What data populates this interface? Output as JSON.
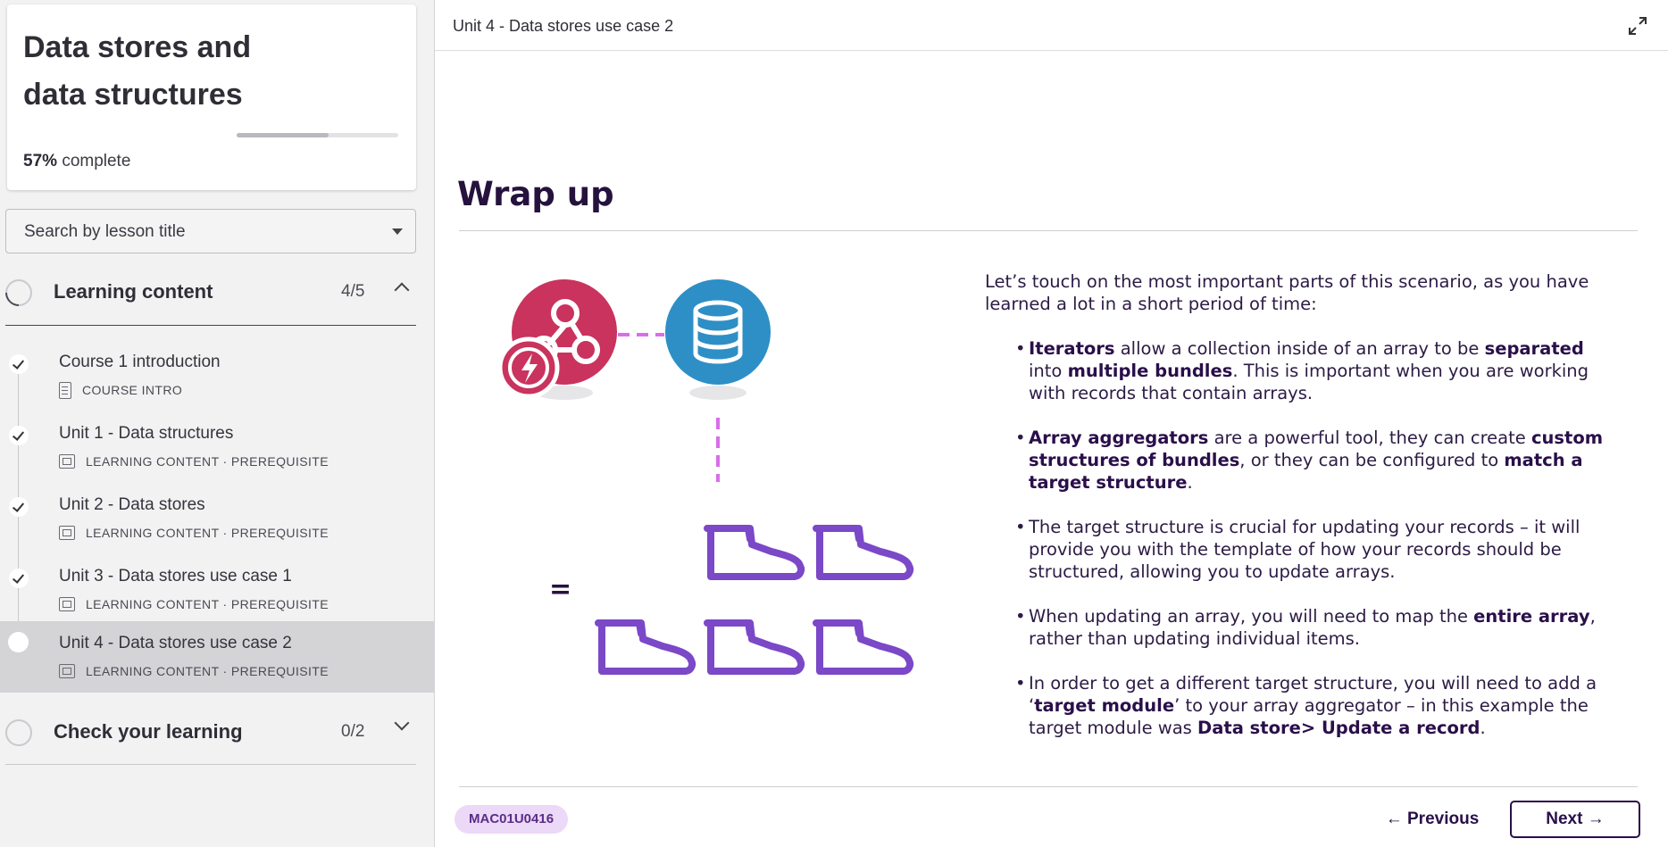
{
  "course": {
    "title": "Data stores and data structures",
    "progress_percent": 57,
    "progress_value": "57%",
    "progress_suffix": "complete"
  },
  "search": {
    "label": "Search by lesson title"
  },
  "sections": [
    {
      "title": "Learning content",
      "count": "4/5",
      "expanded": true
    },
    {
      "title": "Check your learning",
      "count": "0/2",
      "expanded": false
    }
  ],
  "lessons": [
    {
      "title": "Course 1 introduction",
      "meta": "COURSE INTRO",
      "status": "complete"
    },
    {
      "title": "Unit 1 - Data structures",
      "meta": "LEARNING CONTENT · PREREQUISITE",
      "status": "complete"
    },
    {
      "title": "Unit 2 - Data stores",
      "meta": "LEARNING CONTENT · PREREQUISITE",
      "status": "complete"
    },
    {
      "title": "Unit 3 - Data stores use case 1",
      "meta": "LEARNING CONTENT · PREREQUISITE",
      "status": "complete"
    },
    {
      "title": "Unit 4 - Data stores use case 2",
      "meta": "LEARNING CONTENT · PREREQUISITE",
      "status": "current"
    }
  ],
  "header": {
    "breadcrumb": "Unit 4 - Data stores use case 2"
  },
  "content": {
    "heading": "Wrap up",
    "equals": "=",
    "intro": "Let’s touch on the most important parts of this scenario, as you have learned a lot in a short period of time:",
    "bullets": [
      [
        {
          "b": "Iterators"
        },
        {
          "t": " allow a collection inside of an array to be "
        },
        {
          "b": "separated"
        },
        {
          "t": " into "
        },
        {
          "b": "multiple bundles"
        },
        {
          "t": ". This is important when you are working with records that contain arrays."
        }
      ],
      [
        {
          "b": "Array aggregators"
        },
        {
          "t": " are a powerful tool, they can create "
        },
        {
          "b": "custom structures of bundles"
        },
        {
          "t": ", or they can be configured to "
        },
        {
          "b": "match a target structure"
        },
        {
          "t": "."
        }
      ],
      [
        {
          "t": "The target structure is crucial for updating your records – it will provide you with the template of how your records should be structured, allowing you to update arrays."
        }
      ],
      [
        {
          "t": "When updating an array, you will need to map the "
        },
        {
          "b": "entire array"
        },
        {
          "t": ", rather than updating individual items."
        }
      ],
      [
        {
          "t": "In order to get a different target structure, you will need to add a ‘"
        },
        {
          "b": "target module"
        },
        {
          "t": "’ to your array aggregator – in this example the target module was "
        },
        {
          "b": "Data store> Update a record"
        },
        {
          "t": "."
        }
      ]
    ]
  },
  "footer": {
    "code": "MAC01U0416",
    "previous_label": "← Previous",
    "next_label": "Next →"
  },
  "colors": {
    "webhook_red": "#c9335e",
    "datastore_blue": "#2e8fc6",
    "connector_pink": "#d86ee8",
    "boot_purple": "#7b48c8",
    "heading_purple": "#25123d"
  },
  "icons": [
    "webhook-icon",
    "lightning-icon",
    "database-icon",
    "boot-icon",
    "expand-icon",
    "check-icon",
    "chevron-up-icon",
    "chevron-down-icon",
    "slides-icon",
    "document-icon"
  ]
}
